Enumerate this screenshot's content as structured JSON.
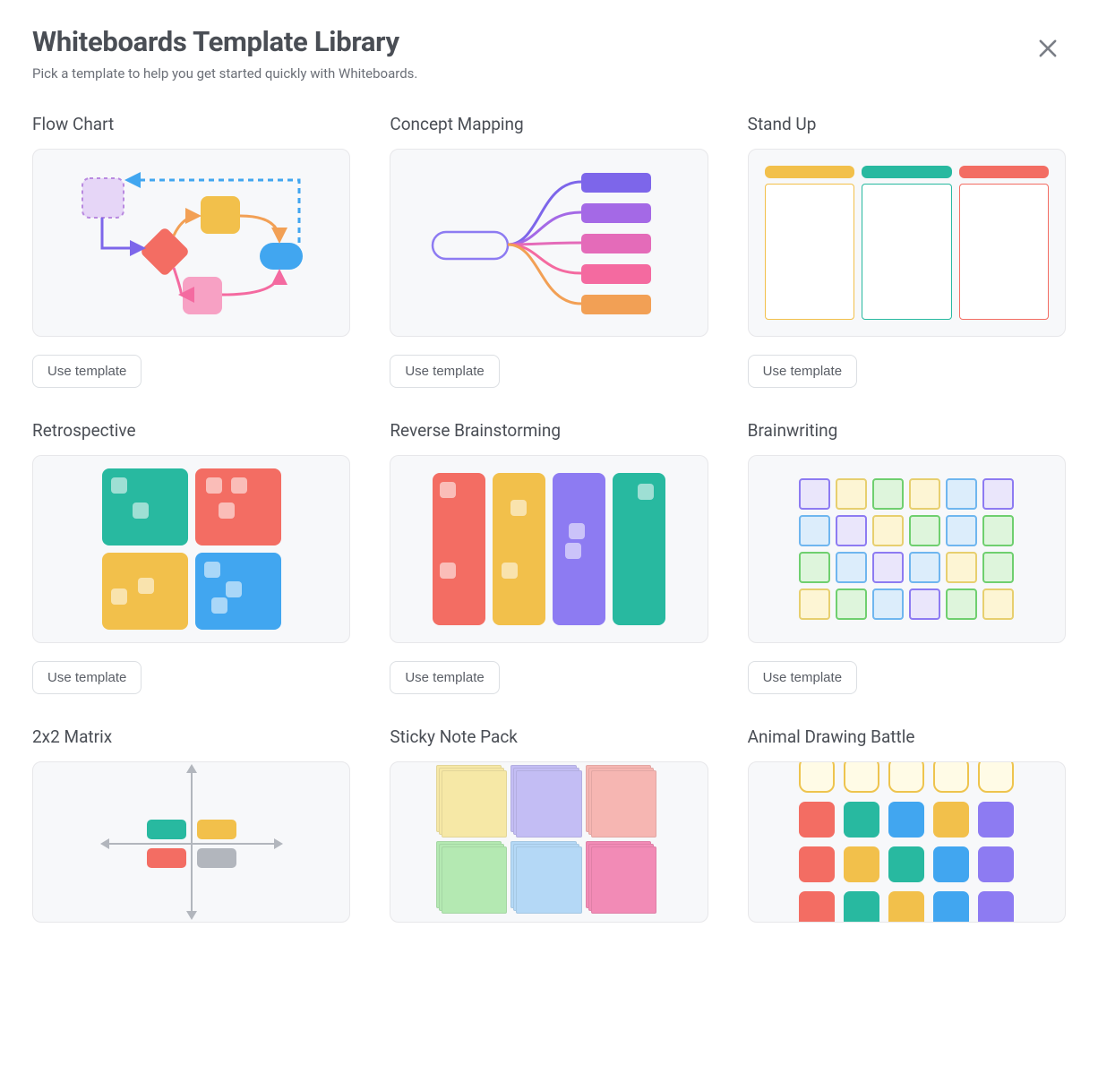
{
  "dialog": {
    "title": "Whiteboards Template Library",
    "subtitle": "Pick a template to help you get started quickly with Whiteboards."
  },
  "buttons": {
    "use_template": "Use template"
  },
  "templates": [
    {
      "id": "flow-chart",
      "title": "Flow Chart"
    },
    {
      "id": "concept-mapping",
      "title": "Concept Mapping"
    },
    {
      "id": "stand-up",
      "title": "Stand Up"
    },
    {
      "id": "retrospective",
      "title": "Retrospective"
    },
    {
      "id": "reverse-brainstorming",
      "title": "Reverse Brainstorming"
    },
    {
      "id": "brainwriting",
      "title": "Brainwriting"
    },
    {
      "id": "2x2-matrix",
      "title": "2x2 Matrix"
    },
    {
      "id": "sticky-note-pack",
      "title": "Sticky Note Pack"
    },
    {
      "id": "animal-drawing-battle",
      "title": "Animal Drawing Battle"
    }
  ],
  "colors": {
    "amber": "#f2c04b",
    "teal": "#28b9a0",
    "coral": "#f36d63",
    "blue": "#41a6f0",
    "violet": "#8d7bf2",
    "pink": "#f28bb6",
    "green": "#8ed98c",
    "lavender": "#c3bdf4",
    "butter": "#f6e8a6",
    "mint": "#b4e9b2",
    "sky": "#b4d8f6",
    "rose": "#f6b6b2",
    "grey": "#b2b6bd",
    "orange": "#f2a055",
    "purple": "#a469e6",
    "magenta": "#e46bb9",
    "hotpink": "#f46aa0",
    "indigo": "#7d66ea"
  },
  "standup_columns": [
    "amber",
    "teal",
    "coral"
  ],
  "retrospective_quadrants": [
    "teal",
    "coral",
    "amber",
    "blue"
  ],
  "reverse_brainstorming_columns": [
    "coral",
    "amber",
    "violet",
    "teal"
  ],
  "brainwriting_rows": [
    [
      "lavender",
      "butter",
      "mint",
      "butter",
      "sky",
      "lavender"
    ],
    [
      "sky",
      "lavender",
      "butter",
      "mint",
      "sky",
      "mint"
    ],
    [
      "mint",
      "sky",
      "lavender",
      "sky",
      "butter",
      "mint"
    ],
    [
      "butter",
      "mint",
      "sky",
      "lavender",
      "mint",
      "butter"
    ]
  ],
  "animal_drawing_rows": [
    [
      "outline",
      "outline",
      "outline",
      "outline",
      "outline"
    ],
    [
      "coral",
      "teal",
      "blue",
      "amber",
      "violet"
    ],
    [
      "coral",
      "amber",
      "teal",
      "blue",
      "violet"
    ],
    [
      "coral",
      "teal",
      "amber",
      "blue",
      "violet"
    ]
  ],
  "sticky_note_colors": [
    [
      "butter",
      "lavender",
      "rose"
    ],
    [
      "mint",
      "sky",
      "pink"
    ]
  ],
  "concept_mapping_branches": [
    "indigo",
    "purple",
    "magenta",
    "hotpink",
    "orange"
  ],
  "matrix_chips": [
    {
      "color": "teal",
      "quadrant": "top-left"
    },
    {
      "color": "amber",
      "quadrant": "top-right"
    },
    {
      "color": "coral",
      "quadrant": "bottom-left"
    },
    {
      "color": "grey",
      "quadrant": "bottom-right"
    }
  ]
}
